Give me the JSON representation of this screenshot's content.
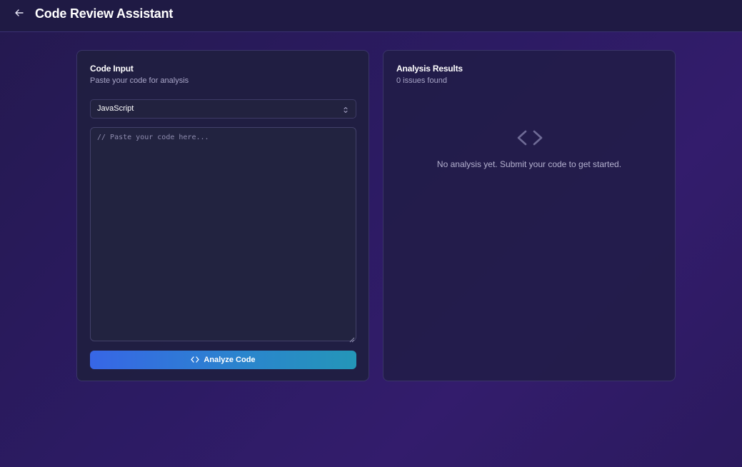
{
  "header": {
    "title": "Code Review Assistant",
    "back_icon": "arrow-left-icon"
  },
  "input_panel": {
    "title": "Code Input",
    "subtitle": "Paste your code for analysis",
    "language_select": {
      "selected": "JavaScript"
    },
    "code_editor": {
      "value": "",
      "placeholder": "// Paste your code here..."
    },
    "analyze_button": {
      "label": "Analyze Code",
      "icon": "code-icon"
    }
  },
  "results_panel": {
    "title": "Analysis Results",
    "subtitle": "0 issues found",
    "empty_icon": "code-icon",
    "empty_message": "No analysis yet. Submit your code to get started."
  },
  "colors": {
    "accent_start": "#3766e6",
    "accent_end": "#2496b8",
    "background": "#2c1b63"
  }
}
